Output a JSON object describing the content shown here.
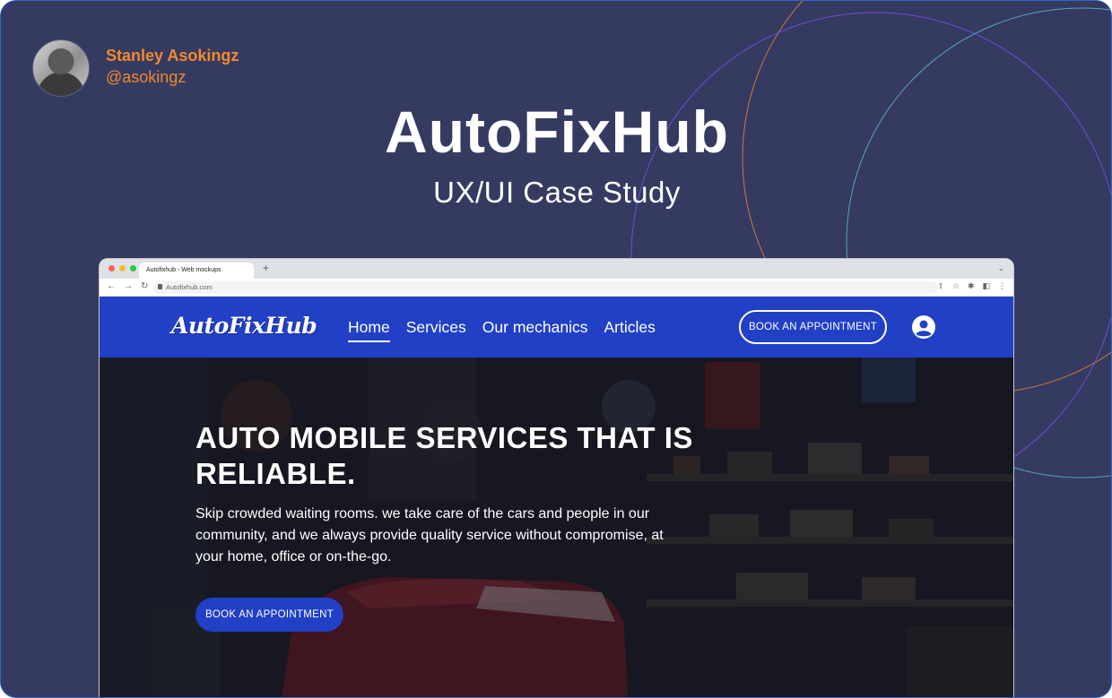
{
  "author": {
    "name": "Stanley Asokingz",
    "handle": "@asokingz"
  },
  "title": "AutoFixHub",
  "subtitle": "UX/UI Case Study",
  "colors": {
    "background": "#353a61",
    "accent_orange": "#f08a2c",
    "site_blue": "#2140c6",
    "deco_purple": "#7a4fe0",
    "deco_teal": "#5fb7c4"
  },
  "browser": {
    "tab_title": "Autofixhub - Web mockups",
    "new_tab": "+",
    "url": "Autofixhub.com",
    "icons": [
      "back-icon",
      "forward-icon",
      "reload-icon",
      "share-icon",
      "star-icon",
      "extensions-icon",
      "sidepanel-icon",
      "more-icon"
    ]
  },
  "site": {
    "logo": "AutoFixHub",
    "nav": [
      {
        "label": "Home",
        "active": true
      },
      {
        "label": "Services",
        "active": false
      },
      {
        "label": "Our mechanics",
        "active": false
      },
      {
        "label": "Articles",
        "active": false
      }
    ],
    "nav_cta": "BOOK AN APPOINTMENT",
    "hero": {
      "title": "AUTO MOBILE SERVICES THAT IS RELIABLE.",
      "body": "Skip crowded waiting rooms. we take care of the cars and people in our community, and we always provide quality service without compromise, at your home, office or on-the-go.",
      "cta": "BOOK AN APPOINTMENT"
    }
  }
}
